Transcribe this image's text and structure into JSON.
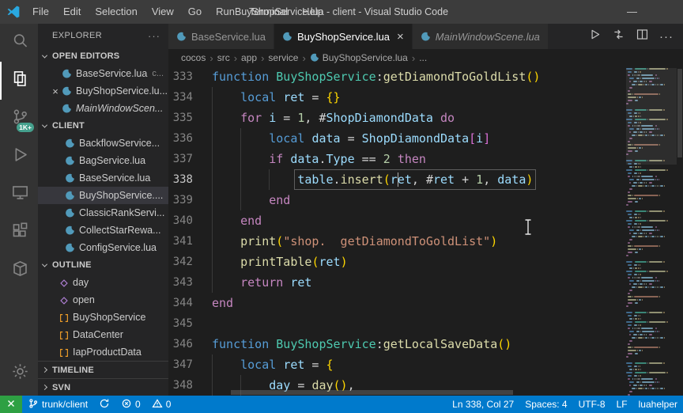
{
  "title_bar": {
    "menus": [
      "File",
      "Edit",
      "Selection",
      "View",
      "Go",
      "Run",
      "Terminal",
      "Help"
    ],
    "title": "BuyShopService.lua - client - Visual Studio Code",
    "minimize_glyph": "—"
  },
  "colors": {
    "status_bar": "#007acc",
    "remote_indicator": "#2ea043",
    "activity_badge": "#45a08d",
    "lua_icon": "#519aba",
    "syntax": {
      "keyword": "#C586C0",
      "declaration": "#569CD6",
      "function": "#DCDCAA",
      "variable": "#9CDCFE",
      "number": "#B5CEA8",
      "string": "#CE9178",
      "class": "#4EC9B0",
      "punctuation": "#D4D4D4",
      "bracket": "#FFD700"
    }
  },
  "activity_bar": {
    "items": [
      {
        "icon": "search-icon"
      },
      {
        "icon": "explorer-icon",
        "active": true
      },
      {
        "icon": "source-control-icon",
        "badge": "1K+"
      },
      {
        "icon": "run-debug-icon"
      },
      {
        "icon": "remote-explorer-icon"
      },
      {
        "icon": "extensions-icon"
      },
      {
        "icon": "package-icon"
      }
    ],
    "bottom": [
      {
        "icon": "settings-gear-icon"
      }
    ]
  },
  "sidebar": {
    "title": "EXPLORER",
    "actions_glyph": "···",
    "sections": {
      "open_editors": {
        "label": "OPEN EDITORS",
        "items": [
          {
            "label": "BaseService.lua",
            "detail": "c..."
          },
          {
            "label": "BuyShopService.lu...",
            "close": true
          },
          {
            "label": "MainWindowScen...",
            "preview": true
          }
        ]
      },
      "folder": {
        "label": "CLIENT",
        "items": [
          {
            "label": "BackflowService..."
          },
          {
            "label": "BagService.lua"
          },
          {
            "label": "BaseService.lua"
          },
          {
            "label": "BuyShopService....",
            "selected": true
          },
          {
            "label": "ClassicRankServi..."
          },
          {
            "label": "CollectStarRewa..."
          },
          {
            "label": "ConfigService.lua"
          }
        ]
      },
      "outline": {
        "label": "OUTLINE",
        "items": [
          {
            "label": "day",
            "kind": "field"
          },
          {
            "label": "open",
            "kind": "field"
          },
          {
            "label": "BuyShopService",
            "kind": "class"
          },
          {
            "label": "DataCenter",
            "kind": "class"
          },
          {
            "label": "IapProductData",
            "kind": "class"
          }
        ]
      },
      "timeline": {
        "label": "TIMELINE"
      },
      "svn": {
        "label": "SVN"
      }
    }
  },
  "tab_bar": {
    "tabs": [
      {
        "label": "BaseService.lua"
      },
      {
        "label": "BuyShopService.lua",
        "active": true,
        "close": true
      },
      {
        "label": "MainWindowScene.lua",
        "preview": true
      }
    ],
    "actions": [
      "run-file-icon",
      "compare-changes-icon",
      "split-editor-icon",
      "more-actions-icon"
    ],
    "close_glyph": "×",
    "more_glyph": "···"
  },
  "breadcrumbs": [
    "cocos",
    "src",
    "app",
    "service",
    "BuyShopService.lua",
    "..."
  ],
  "editor": {
    "cursor": {
      "line": 338,
      "col": 27
    },
    "lines": [
      {
        "n": 333,
        "ind": 0,
        "t": [
          [
            "d",
            "function"
          ],
          [
            "p",
            " "
          ],
          [
            "c",
            "BuyShopService"
          ],
          [
            "p",
            ":"
          ],
          [
            "f",
            "getDiamondToGoldList"
          ],
          [
            "b",
            "()"
          ]
        ]
      },
      {
        "n": 334,
        "ind": 1,
        "t": [
          [
            "d",
            "local"
          ],
          [
            "p",
            " "
          ],
          [
            "v",
            "ret"
          ],
          [
            "p",
            " = "
          ],
          [
            "b",
            "{}"
          ]
        ]
      },
      {
        "n": 335,
        "ind": 1,
        "t": [
          [
            "k",
            "for"
          ],
          [
            "p",
            " "
          ],
          [
            "v",
            "i"
          ],
          [
            "p",
            " = "
          ],
          [
            "n",
            "1"
          ],
          [
            "p",
            ", #"
          ],
          [
            "v",
            "ShopDiamondData"
          ],
          [
            "p",
            " "
          ],
          [
            "k",
            "do"
          ]
        ]
      },
      {
        "n": 336,
        "ind": 2,
        "t": [
          [
            "d",
            "local"
          ],
          [
            "p",
            " "
          ],
          [
            "v",
            "data"
          ],
          [
            "p",
            " = "
          ],
          [
            "v",
            "ShopDiamondData"
          ],
          [
            "b2",
            "["
          ],
          [
            "v",
            "i"
          ],
          [
            "b2",
            "]"
          ]
        ]
      },
      {
        "n": 337,
        "ind": 2,
        "t": [
          [
            "k",
            "if"
          ],
          [
            "p",
            " "
          ],
          [
            "v",
            "data"
          ],
          [
            "p",
            "."
          ],
          [
            "v",
            "Type"
          ],
          [
            "p",
            " == "
          ],
          [
            "n",
            "2"
          ],
          [
            "p",
            " "
          ],
          [
            "k",
            "then"
          ]
        ]
      },
      {
        "n": 338,
        "ind": 3,
        "current": true,
        "t": [
          [
            "v",
            "table"
          ],
          [
            "p",
            "."
          ],
          [
            "f",
            "insert"
          ],
          [
            "b",
            "("
          ],
          [
            "v",
            "ret"
          ],
          [
            "p",
            ", "
          ],
          [
            "p",
            "#"
          ],
          [
            "v",
            "ret"
          ],
          [
            "p",
            " + "
          ],
          [
            "n",
            "1"
          ],
          [
            "p",
            ", "
          ],
          [
            "v",
            "data"
          ],
          [
            "b",
            ")"
          ]
        ]
      },
      {
        "n": 339,
        "ind": 2,
        "t": [
          [
            "k",
            "end"
          ]
        ]
      },
      {
        "n": 340,
        "ind": 1,
        "t": [
          [
            "k",
            "end"
          ]
        ]
      },
      {
        "n": 341,
        "ind": 1,
        "t": [
          [
            "f",
            "print"
          ],
          [
            "b",
            "("
          ],
          [
            "s",
            "\"shop.  getDiamondToGoldList\""
          ],
          [
            "b",
            ")"
          ]
        ]
      },
      {
        "n": 342,
        "ind": 1,
        "t": [
          [
            "f",
            "printTable"
          ],
          [
            "b",
            "("
          ],
          [
            "v",
            "ret"
          ],
          [
            "b",
            ")"
          ]
        ]
      },
      {
        "n": 343,
        "ind": 1,
        "t": [
          [
            "k",
            "return"
          ],
          [
            "p",
            " "
          ],
          [
            "v",
            "ret"
          ]
        ]
      },
      {
        "n": 344,
        "ind": 0,
        "t": [
          [
            "k",
            "end"
          ]
        ]
      },
      {
        "n": 345,
        "ind": 0,
        "t": []
      },
      {
        "n": 346,
        "ind": 0,
        "t": [
          [
            "d",
            "function"
          ],
          [
            "p",
            " "
          ],
          [
            "c",
            "BuyShopService"
          ],
          [
            "p",
            ":"
          ],
          [
            "f",
            "getLocalSaveData"
          ],
          [
            "b",
            "()"
          ]
        ]
      },
      {
        "n": 347,
        "ind": 1,
        "t": [
          [
            "d",
            "local"
          ],
          [
            "p",
            " "
          ],
          [
            "v",
            "ret"
          ],
          [
            "p",
            " = "
          ],
          [
            "b",
            "{"
          ]
        ]
      },
      {
        "n": 348,
        "ind": 2,
        "t": [
          [
            "v",
            "day"
          ],
          [
            "p",
            " = "
          ],
          [
            "f",
            "day"
          ],
          [
            "b",
            "()"
          ],
          [
            "p",
            ","
          ]
        ]
      }
    ]
  },
  "status_bar": {
    "left": [
      {
        "name": "remote-indicator",
        "icon": "remote-icon",
        "label": ""
      },
      {
        "name": "branch-item",
        "icon": "branch-icon",
        "label": "trunk/client"
      },
      {
        "name": "sync-item",
        "icon": "sync-icon",
        "label": ""
      },
      {
        "name": "problems-errors",
        "icon": "error-icon",
        "label": "0"
      },
      {
        "name": "problems-warnings",
        "icon": "warning-icon",
        "label": "0"
      }
    ],
    "right": [
      {
        "name": "cursor-position",
        "label": "Ln 338, Col 27"
      },
      {
        "name": "indentation",
        "label": "Spaces: 4"
      },
      {
        "name": "encoding",
        "label": "UTF-8"
      },
      {
        "name": "eol",
        "label": "LF"
      },
      {
        "name": "language-mode",
        "label": "luahelper"
      }
    ]
  }
}
